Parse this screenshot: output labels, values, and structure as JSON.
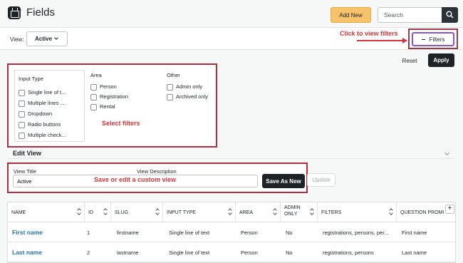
{
  "header": {
    "title": "Fields",
    "add_new_label": "Add New",
    "search_placeholder": "Search"
  },
  "viewbar": {
    "view_label": "View:",
    "view_selected": "Active",
    "filters_label": "Filters"
  },
  "annotations": {
    "click_filters": "Click to view filters",
    "select_filters": "Select filters",
    "save_view": "Save or edit a custom view"
  },
  "filter_actions": {
    "reset_label": "Reset",
    "apply_label": "Apply"
  },
  "filters": {
    "input_type": {
      "title": "Input Type",
      "options": [
        "Single line of t...",
        "Multiple lines ...",
        "Dropdown",
        "Radio buttons",
        "Multiple check..."
      ]
    },
    "area": {
      "title": "Area",
      "options": [
        "Person",
        "Registration",
        "Rental"
      ]
    },
    "other": {
      "title": "Other",
      "options": [
        "Admin only",
        "Archived only"
      ]
    }
  },
  "edit_view": {
    "title": "Edit View",
    "view_title_label": "View Title",
    "view_description_label": "View Description",
    "view_title_value": "Active",
    "save_as_new_label": "Save As New",
    "update_label": "Update"
  },
  "table": {
    "columns": [
      "NAME",
      "ID",
      "SLUG",
      "INPUT TYPE",
      "AREA",
      "ADMIN ONLY",
      "FILTERS",
      "QUESTION PROMI"
    ],
    "rows": [
      {
        "name": "First name",
        "id": "1",
        "slug": "firstname",
        "input_type": "Single line of text",
        "area": "Person",
        "admin_only": "No",
        "filters": "registrations, persons, per...",
        "question": "First name"
      },
      {
        "name": "Last name",
        "id": "2",
        "slug": "lastname",
        "input_type": "Single line of text",
        "area": "Person",
        "admin_only": "No",
        "filters": "registrations, persons",
        "question": "Last name"
      }
    ],
    "add_column_label": "+"
  },
  "colors": {
    "accent_dark": "#1d2327",
    "add_new_bg": "#f6c26b",
    "annotation_red": "#d63638",
    "link_blue": "#2271b1",
    "filters_border": "#8e54c2"
  }
}
